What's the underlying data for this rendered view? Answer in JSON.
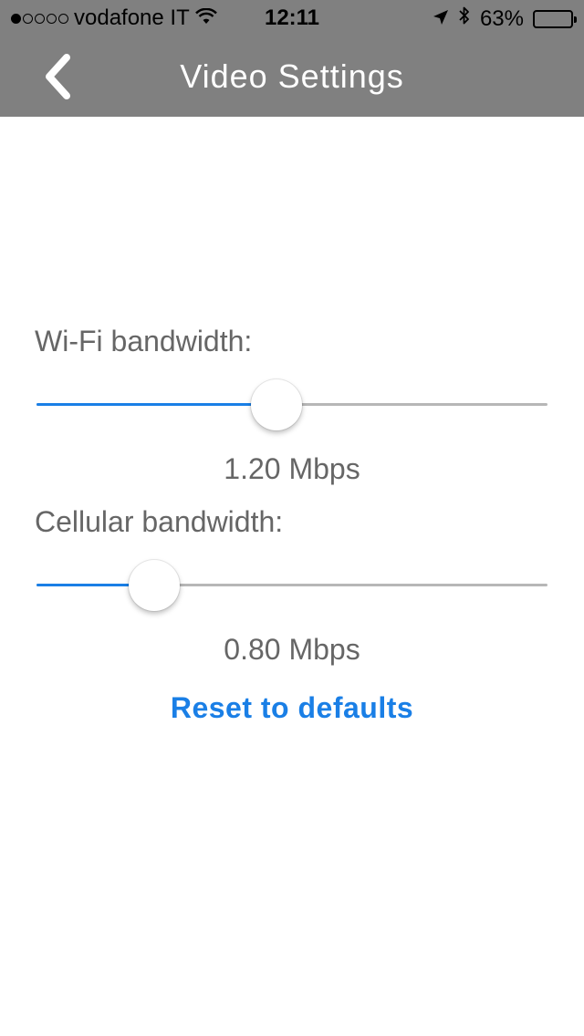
{
  "status_bar": {
    "carrier": "vodafone IT",
    "signal_bars_filled": 1,
    "signal_bars_total": 5,
    "time": "12:11",
    "battery_percent_text": "63%",
    "battery_level": 0.63
  },
  "nav": {
    "back_icon": "chevron-left-icon",
    "title": "Video Settings"
  },
  "wifi": {
    "label": "Wi-Fi bandwidth:",
    "value_text": "1.20 Mbps",
    "slider_fraction": 0.47
  },
  "cellular": {
    "label": "Cellular bandwidth:",
    "value_text": "0.80 Mbps",
    "slider_fraction": 0.23
  },
  "reset_label": "Reset to defaults",
  "colors": {
    "header_bg": "#808080",
    "accent": "#1a7fe6",
    "text_gray": "#666666",
    "track_gray": "#b7b7b7"
  }
}
